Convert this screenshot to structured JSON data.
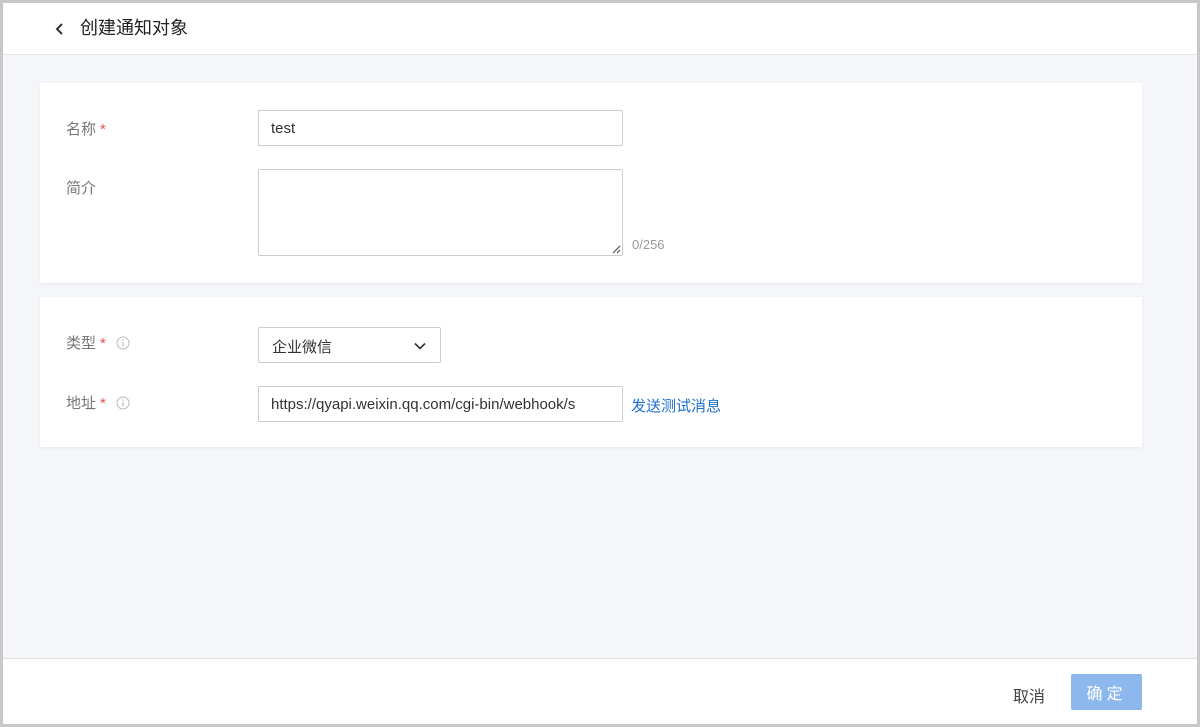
{
  "header": {
    "title": "创建通知对象",
    "back_icon": "chevron-left-icon"
  },
  "basic": {
    "name": {
      "label": "名称",
      "required": "*",
      "value": "test"
    },
    "description": {
      "label": "简介",
      "value": "",
      "counter": "0/256"
    }
  },
  "config": {
    "type": {
      "label": "类型",
      "required": "*",
      "selected": "企业微信",
      "icon": "info-icon"
    },
    "address": {
      "label": "地址",
      "required": "*",
      "value": "https://qyapi.weixin.qq.com/cgi-bin/webhook/s",
      "icon": "info-icon",
      "test_link": "发送测试消息"
    }
  },
  "footer": {
    "cancel_label": "取消",
    "confirm_label": "确定"
  },
  "colors": {
    "accent": "#1e6fd2",
    "confirm_disabled": "#8db8ee",
    "required": "#e5534b"
  }
}
